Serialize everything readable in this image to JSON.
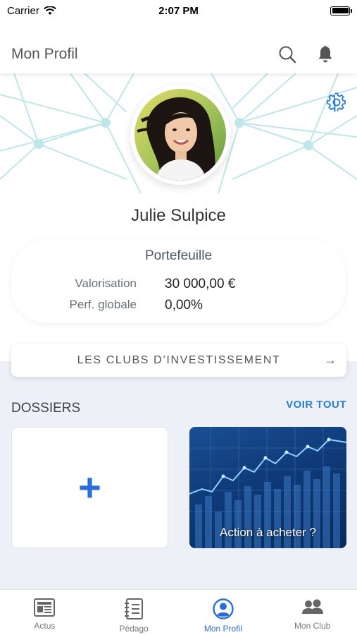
{
  "status_bar": {
    "carrier": "Carrier",
    "time": "2:07 PM"
  },
  "header": {
    "title": "Mon Profil",
    "search_icon": "search-icon",
    "bell_icon": "bell-icon"
  },
  "profile": {
    "name": "Julie Sulpice",
    "settings_icon": "gear-icon"
  },
  "portfolio": {
    "title": "Portefeuille",
    "rows": [
      {
        "label": "Valorisation",
        "value": "30 000,00 €"
      },
      {
        "label": "Perf. globale",
        "value": "0,00%"
      }
    ]
  },
  "clubs_button": {
    "label": "LES CLUBS D’INVESTISSEMENT",
    "arrow": "→"
  },
  "dossiers": {
    "title": "DOSSIERS",
    "see_all": "VOIR TOUT",
    "add_symbol": "+",
    "cards": [
      {
        "label": "Action à acheter ?"
      }
    ]
  },
  "tabs": [
    {
      "label": "Actus",
      "icon": "newspaper-icon",
      "active": false
    },
    {
      "label": "Pédago",
      "icon": "notebook-icon",
      "active": false
    },
    {
      "label": "Mon Profil",
      "icon": "profile-icon",
      "active": true
    },
    {
      "label": "Mon Club",
      "icon": "group-icon",
      "active": false
    }
  ],
  "colors": {
    "accent": "#2a6fd8",
    "link": "#2a7fd5",
    "network": "#bfe6ea",
    "content_bg": "#edf0f6"
  }
}
